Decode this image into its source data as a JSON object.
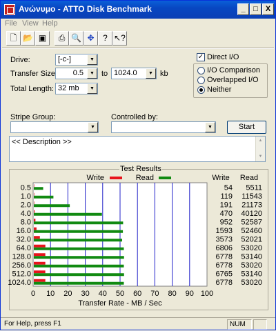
{
  "window": {
    "title": "Ανώνυμο - ATTO Disk Benchmark"
  },
  "titlebar_buttons": {
    "minimize": "_",
    "maximize": "□",
    "close": "X"
  },
  "menu": [
    "File",
    "View",
    "Help"
  ],
  "toolbar_icons": [
    "new-icon",
    "open-icon",
    "save-icon",
    "print-icon",
    "print-preview-icon",
    "move-icon",
    "help-icon",
    "context-help-icon"
  ],
  "settings": {
    "drive_label": "Drive:",
    "drive_value": "[-c-]",
    "transfer_size_label": "Transfer Size:",
    "transfer_from": "0.5",
    "transfer_to_word": "to",
    "transfer_to": "1024.0",
    "transfer_unit": "kb",
    "total_length_label": "Total Length:",
    "total_length_value": "32 mb",
    "direct_io_label": "Direct I/O",
    "direct_io_checked": true,
    "radio_options": [
      "I/O Comparison",
      "Overlapped I/O",
      "Neither"
    ],
    "radio_selected": "Neither",
    "stripe_group_label": "Stripe Group:",
    "stripe_group_value": "",
    "controlled_by_label": "Controlled by:",
    "controlled_by_value": "",
    "start_label": "Start",
    "description_text": "<< Description >>"
  },
  "results": {
    "group_title": "Test Results",
    "legend_write": "Write",
    "legend_read": "Read",
    "col_write": "Write",
    "col_read": "Read",
    "write_color": "#e8141c",
    "read_color": "#118a11",
    "xlabel": "Transfer Rate - MB / Sec"
  },
  "chart_data": {
    "type": "bar",
    "orientation": "horizontal",
    "categories": [
      "0.5",
      "1.0",
      "2.0",
      "4.0",
      "8.0",
      "16.0",
      "32.0",
      "64.0",
      "128.0",
      "256.0",
      "512.0",
      "1024.0"
    ],
    "series": [
      {
        "name": "Write",
        "values": [
          54,
          119,
          191,
          470,
          952,
          1593,
          3573,
          6806,
          6778,
          6778,
          6765,
          6778
        ]
      },
      {
        "name": "Read",
        "values": [
          5511,
          11543,
          21173,
          40120,
          52587,
          52460,
          52021,
          53020,
          53140,
          53020,
          53140,
          53020
        ]
      }
    ],
    "bar_values_mb": {
      "write": [
        0.05,
        0.12,
        0.19,
        0.46,
        0.93,
        1.56,
        3.49,
        6.65,
        6.62,
        6.62,
        6.61,
        6.62
      ],
      "read": [
        5.38,
        11.27,
        20.68,
        39.18,
        51.35,
        51.23,
        50.8,
        51.78,
        51.89,
        51.78,
        51.89,
        51.78
      ]
    },
    "xticks": [
      "0",
      "10",
      "20",
      "30",
      "40",
      "50",
      "60",
      "70",
      "80",
      "90",
      "100"
    ],
    "xlim": [
      0,
      100
    ],
    "xlabel": "Transfer Rate - MB / Sec",
    "grid": true
  },
  "status": {
    "help_text": "For Help, press F1",
    "num": "NUM"
  }
}
